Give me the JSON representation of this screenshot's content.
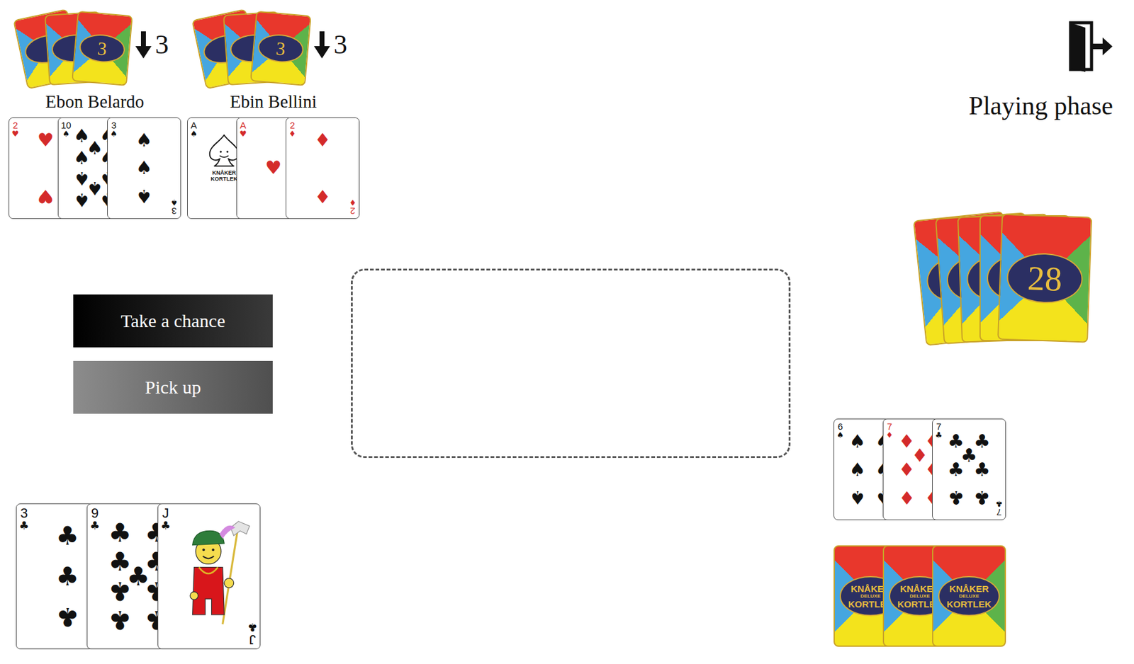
{
  "phase": "Playing phase",
  "card_back_text": [
    "KNÅKER",
    "DELUXE",
    "KORTLEK"
  ],
  "opponents": [
    {
      "name": "Ebon Belardo",
      "hand_count": "3",
      "face_down_count": "3",
      "face_up": [
        {
          "rank": "2",
          "suit": "♥",
          "kind": "pips"
        },
        {
          "rank": "10",
          "suit": "♠",
          "kind": "pips"
        },
        {
          "rank": "3",
          "suit": "♠",
          "kind": "pips"
        }
      ]
    },
    {
      "name": "Ebin Bellini",
      "hand_count": "3",
      "face_down_count": "3",
      "face_up": [
        {
          "rank": "A",
          "suit": "♠",
          "kind": "art",
          "art_text": [
            "KNÅKER",
            "KORTLEK"
          ]
        },
        {
          "rank": "A",
          "suit": "♥",
          "kind": "pips"
        },
        {
          "rank": "2",
          "suit": "♦",
          "kind": "pips"
        }
      ]
    }
  ],
  "buttons": [
    {
      "label": "Take a chance",
      "disabled": false
    },
    {
      "label": "Pick up",
      "disabled": true
    }
  ],
  "pile": [],
  "deck": {
    "count": "28"
  },
  "player": {
    "face_up": [
      {
        "rank": "6",
        "suit": "♠",
        "kind": "pips"
      },
      {
        "rank": "7",
        "suit": "♦",
        "kind": "pips"
      },
      {
        "rank": "7",
        "suit": "♣",
        "kind": "pips"
      }
    ],
    "face_down": 3,
    "hand": [
      {
        "rank": "3",
        "suit": "♣",
        "kind": "pips"
      },
      {
        "rank": "9",
        "suit": "♣",
        "kind": "pips"
      },
      {
        "rank": "J",
        "suit": "♣",
        "kind": "face"
      }
    ]
  }
}
